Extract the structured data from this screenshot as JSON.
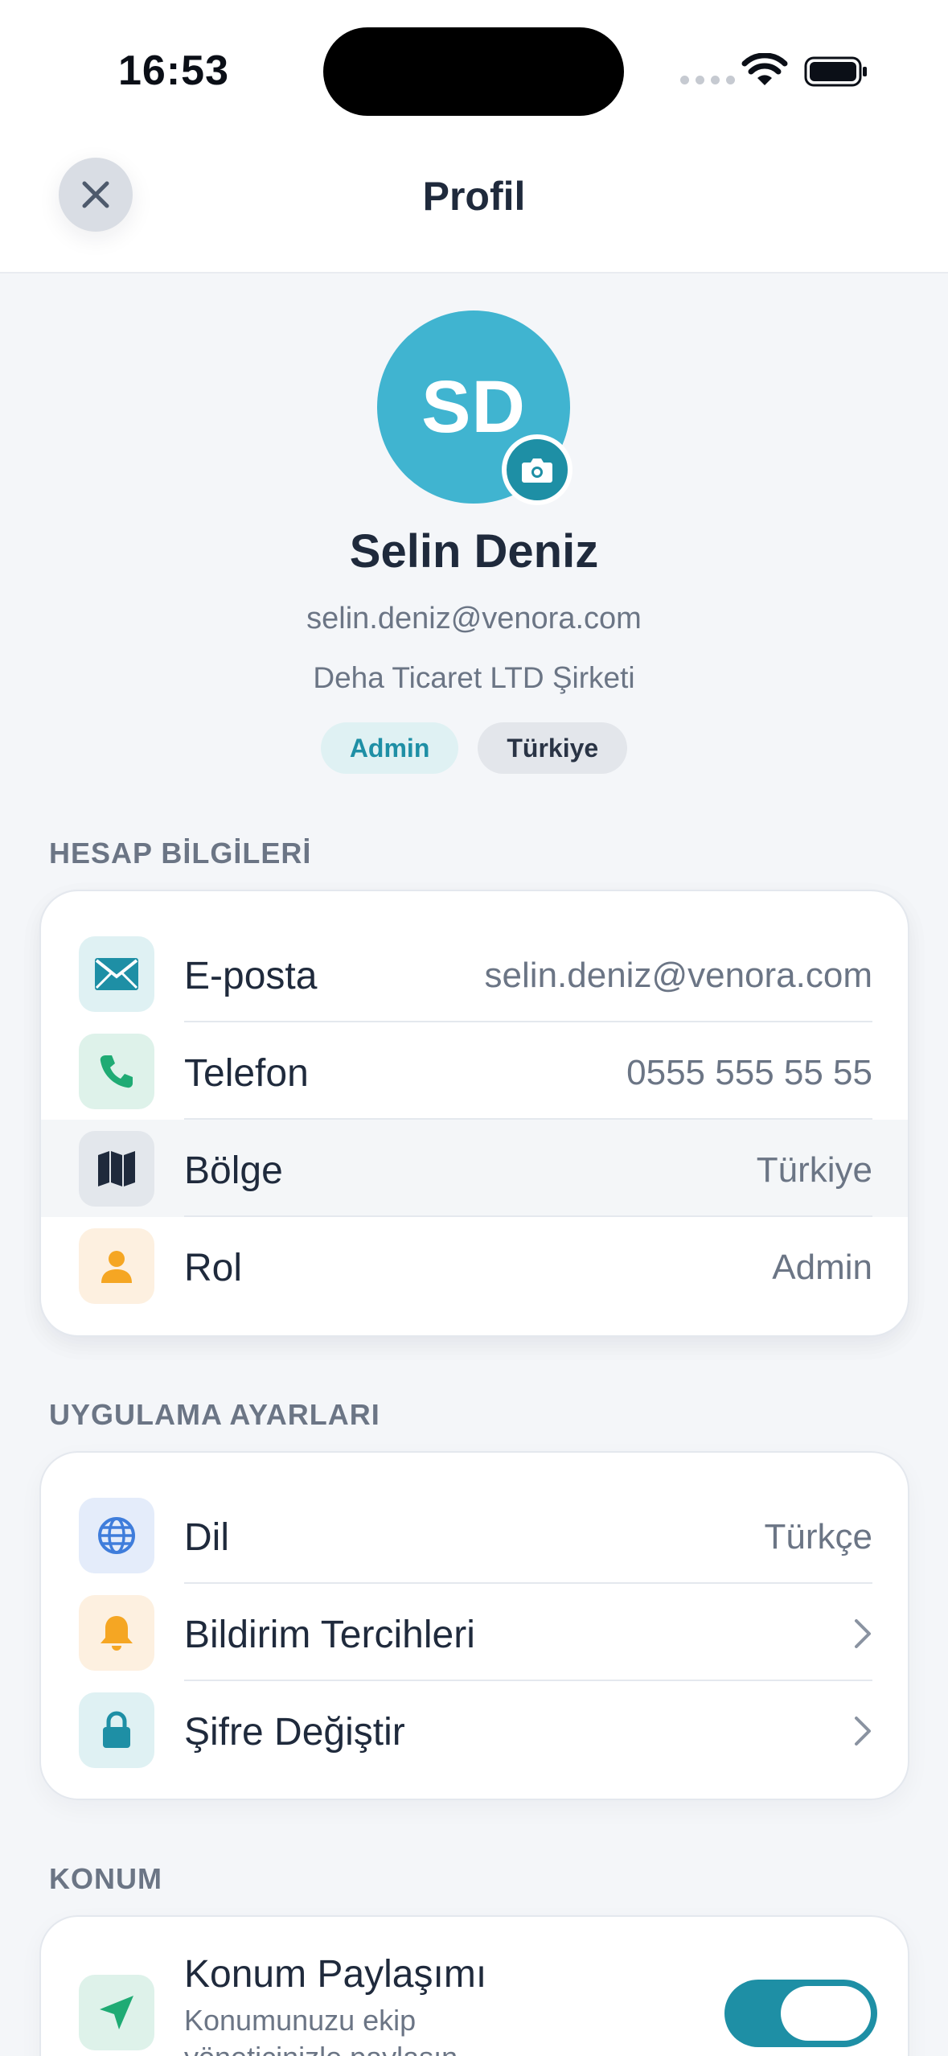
{
  "status_bar": {
    "time": "16:53"
  },
  "header": {
    "title": "Profil",
    "close_icon": "close-icon"
  },
  "profile": {
    "initials": "SD",
    "name": "Selin Deniz",
    "email": "selin.deniz@venora.com",
    "company": "Deha Ticaret LTD Şirketi",
    "badges": [
      "Admin",
      "Türkiye"
    ],
    "avatar_color": "#40b4d0"
  },
  "account_section": {
    "title": "HESAP BİLGİLERİ",
    "rows": [
      {
        "label": "E-posta",
        "value": "selin.deniz@venora.com",
        "icon": "mail-icon"
      },
      {
        "label": "Telefon",
        "value": "0555 555 55 55",
        "icon": "phone-icon"
      },
      {
        "label": "Bölge",
        "value": "Türkiye",
        "icon": "map-icon"
      },
      {
        "label": "Rol",
        "value": "Admin",
        "icon": "user-icon"
      }
    ]
  },
  "app_section": {
    "title": "UYGULAMA AYARLARI",
    "rows": [
      {
        "label": "Dil",
        "value": "Türkçe",
        "icon": "globe-icon"
      },
      {
        "label": "Bildirim Tercihleri",
        "icon": "bell-icon"
      },
      {
        "label": "Şifre Değiştir",
        "icon": "lock-icon"
      }
    ]
  },
  "location_section": {
    "title": "KONUM",
    "item": {
      "label": "Konum Paylaşımı",
      "description": "Konumunuzu ekip yöneticinizle paylaşın",
      "enabled": true,
      "icon": "location-arrow-icon"
    }
  },
  "colors": {
    "accent": "#1e8fa5",
    "background": "#f4f6f9"
  }
}
